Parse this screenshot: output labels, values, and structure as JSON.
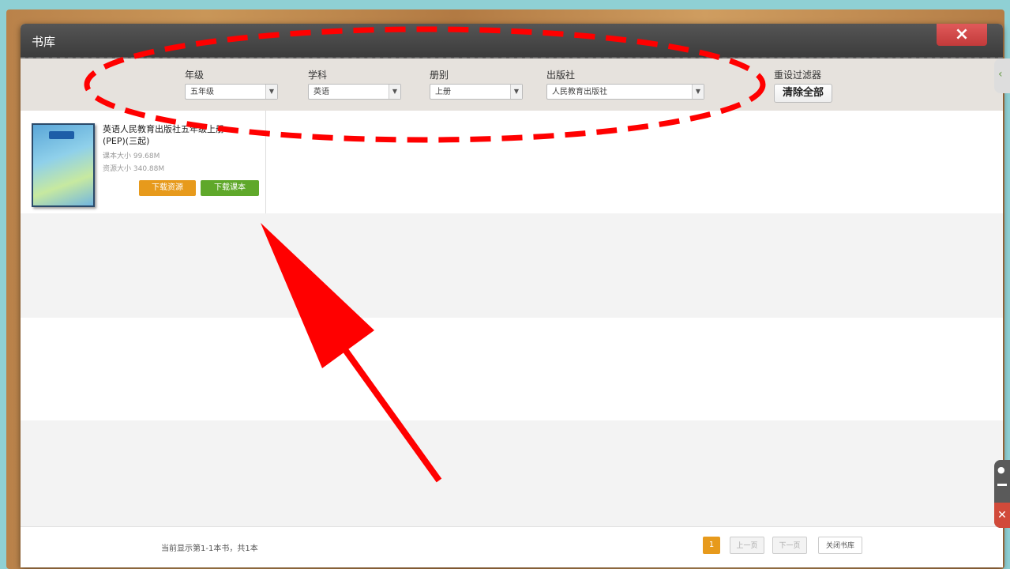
{
  "dialog": {
    "title": "书库",
    "close_icon": "×"
  },
  "filters": {
    "grade": {
      "label": "年级",
      "value": "五年级"
    },
    "subject": {
      "label": "学科",
      "value": "英语"
    },
    "volume": {
      "label": "册别",
      "value": "上册"
    },
    "publisher": {
      "label": "出版社",
      "value": "人民教育出版社"
    },
    "reset": {
      "label": "重设过滤器",
      "button": "清除全部"
    }
  },
  "book": {
    "title": "英语人民教育出版社五年级上册(PEP)(三起)",
    "title_line1": "英语人民教育出版社五年级上册",
    "title_line2": "(PEP)(三起)",
    "book_size": "课本大小 99.68M",
    "resource_size": "资源大小 340.88M",
    "download_resource": "下载资源",
    "download_book": "下载课本"
  },
  "footer": {
    "status": "当前显示第1-1本书，共1本",
    "current_page": "1",
    "prev": "上一页",
    "next": "下一页",
    "close_library": "关闭书库"
  },
  "colors": {
    "annotation": "#ff0000",
    "accent_orange": "#e79a1c",
    "accent_green": "#5fa82a"
  }
}
